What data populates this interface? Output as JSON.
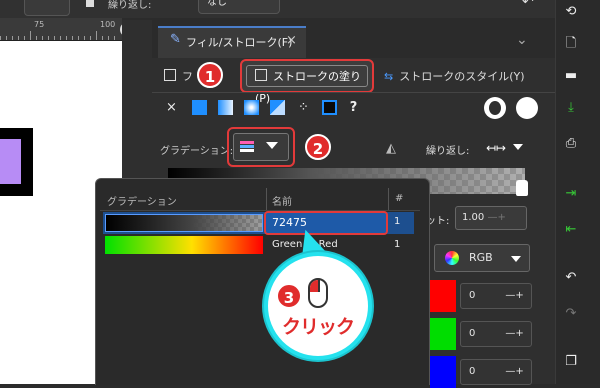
{
  "top": {
    "repeat_label": "繰り返し:",
    "repeat_value": "なし"
  },
  "ruler": {
    "numbers": [
      "75",
      "100"
    ]
  },
  "dialog": {
    "tab_title": "フィル/ストローク(F)",
    "tab_close": "×",
    "subtabs": {
      "fill": "フ",
      "stroke_paint": "ストロークの塗り(P)",
      "stroke_style": "ストロークのスタイル(Y)"
    },
    "paint_types": {
      "none": "×",
      "unset": "?"
    },
    "gradient_label": "グラデーション:",
    "repeat_label": "繰り返し:",
    "offset_label": "ット:",
    "offset_value": "1.00",
    "color_mode": "RGB",
    "channels": [
      {
        "color": "#ff0000",
        "value": "0"
      },
      {
        "color": "#00dd00",
        "value": "0"
      },
      {
        "color": "#0000ff",
        "value": "0"
      }
    ]
  },
  "popup": {
    "headers": {
      "gradient": "グラデーション",
      "name": "名前",
      "count": "#"
    },
    "rows": [
      {
        "name": "72475",
        "count": "1",
        "selected": true
      },
      {
        "name": "Green to Red",
        "count": "1",
        "selected": false
      }
    ]
  },
  "annotations": {
    "step1": "1",
    "step2": "2",
    "step3": "3",
    "click": "クリック"
  },
  "colors": {
    "accent": "#e23a3a",
    "selection": "#1e5aa8",
    "bubble": "#25e2ee"
  }
}
